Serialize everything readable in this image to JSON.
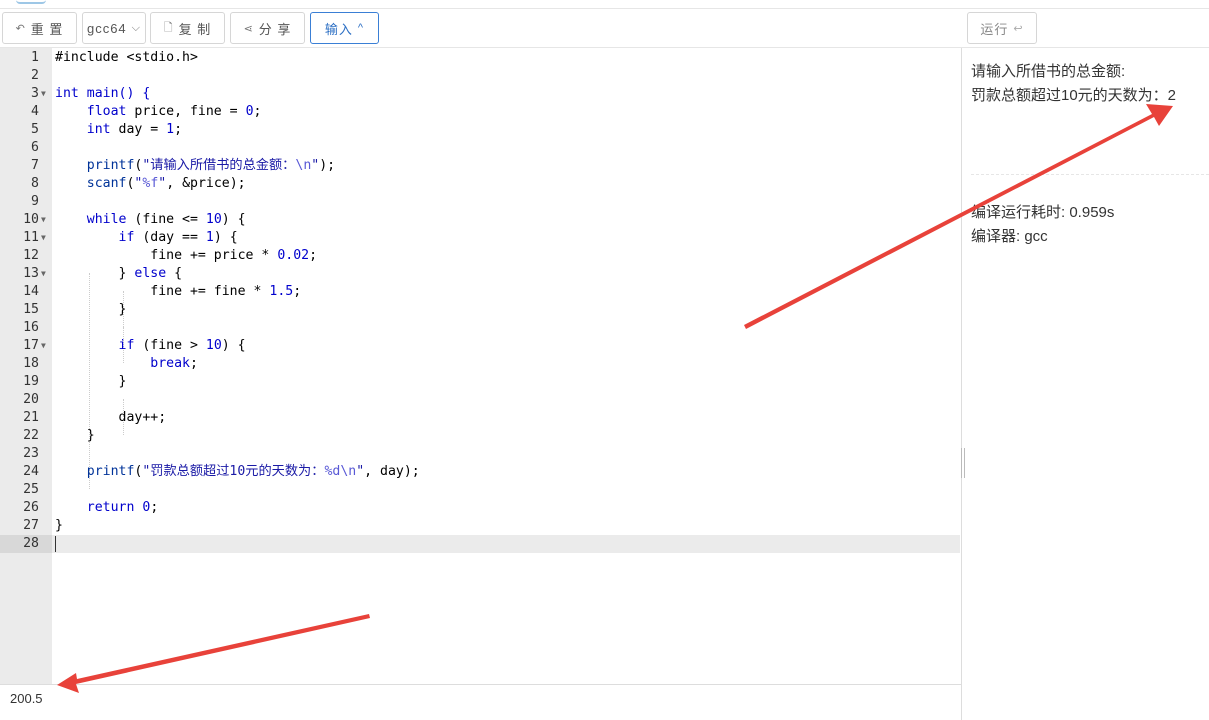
{
  "toolbar": {
    "reset_label": "重 置",
    "compiler_value": "gcc64",
    "copy_label": "复 制",
    "share_label": "分 享",
    "input_label": "输入",
    "run_label": "运行",
    "run_suffix": "↩"
  },
  "editor": {
    "lines": [
      "1",
      "2",
      "3",
      "4",
      "5",
      "6",
      "7",
      "8",
      "9",
      "10",
      "11",
      "12",
      "13",
      "14",
      "15",
      "16",
      "17",
      "18",
      "19",
      "20",
      "21",
      "22",
      "23",
      "24",
      "25",
      "26",
      "27",
      "28"
    ],
    "code": {
      "l1": "#include <stdio.h>",
      "l3": "int main() {",
      "l4a": "float",
      "l4b": " price, fine = ",
      "l4c": "0",
      "l4d": ";",
      "l5a": "int",
      "l5b": " day = ",
      "l5c": "1",
      "l5d": ";",
      "l7a": "printf",
      "l7b": "(",
      "l7c": "\"请输入所借书的总金额：",
      "l7d": "\\n",
      "l7e": "\"",
      "l7f": ");",
      "l8a": "scanf",
      "l8b": "(",
      "l8c": "\"",
      "l8d": "%f",
      "l8e": "\"",
      "l8f": ", &price);",
      "l10a": "while",
      "l10b": " (fine <= ",
      "l10c": "10",
      "l10d": ") {",
      "l11a": "if",
      "l11b": " (day == ",
      "l11c": "1",
      "l11d": ") {",
      "l12a": "fine += price * ",
      "l12b": "0.02",
      "l12c": ";",
      "l13a": "} ",
      "l13b": "else",
      "l13c": " {",
      "l14a": "fine += fine * ",
      "l14b": "1.5",
      "l14c": ";",
      "l15": "}",
      "l17a": "if",
      "l17b": " (fine > ",
      "l17c": "10",
      "l17d": ") {",
      "l18a": "break",
      "l18b": ";",
      "l19": "}",
      "l21": "day++;",
      "l22": "}",
      "l24a": "printf",
      "l24b": "(",
      "l24c": "\"罚款总额超过10元的天数为：",
      "l24d": "%d\\n",
      "l24e": "\"",
      "l24f": ", day);",
      "l26a": "return",
      "l26b": " ",
      "l26c": "0",
      "l26d": ";",
      "l27": "}"
    }
  },
  "stdin": {
    "value": "200.5"
  },
  "output": {
    "line1": "请输入所借书的总金额:",
    "line2": "罚款总额超过10元的天数为：2",
    "time": "编译运行耗时: 0.959s",
    "compiler": "编译器: gcc"
  },
  "colors": {
    "accent": "#3a7fd5",
    "annotation": "#e8423a"
  }
}
